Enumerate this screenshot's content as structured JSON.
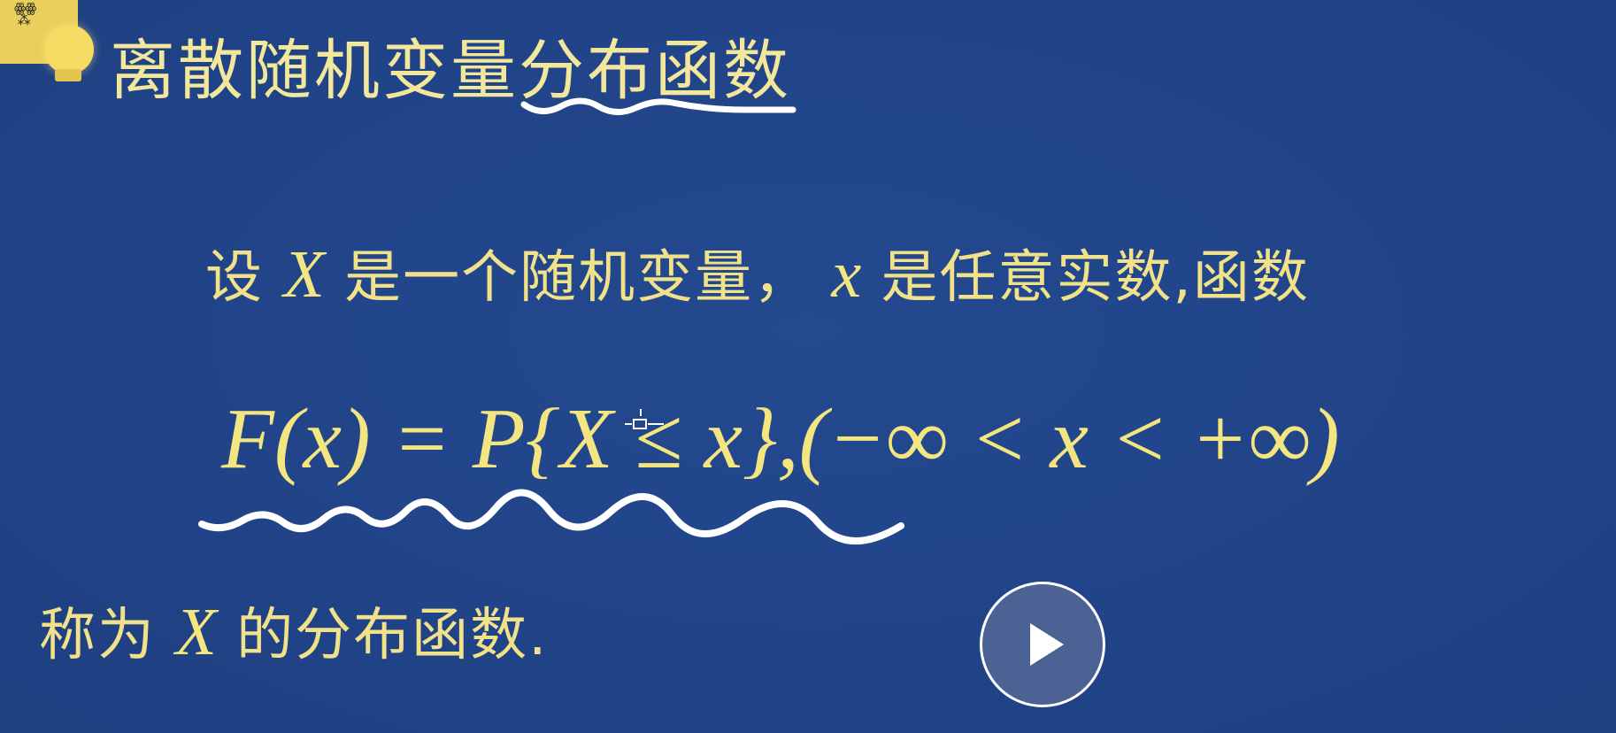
{
  "title": "离散随机变量分布函数",
  "intro": {
    "prefix": "设",
    "var_X": "X",
    "middle": "是一个随机变量，",
    "var_x": "x",
    "suffix": "是任意实数,函数"
  },
  "formula": "F(x) = P{X ≤ x},(−∞ < x < +∞)",
  "conclusion": {
    "prefix": "称为",
    "var_X": "X",
    "suffix": "的分布函数."
  },
  "colors": {
    "background": "#21458c",
    "text": "#f1e28a",
    "ink": "#ffffff"
  },
  "icons": {
    "play": "play-icon",
    "logo": "lightbulb-logo"
  }
}
